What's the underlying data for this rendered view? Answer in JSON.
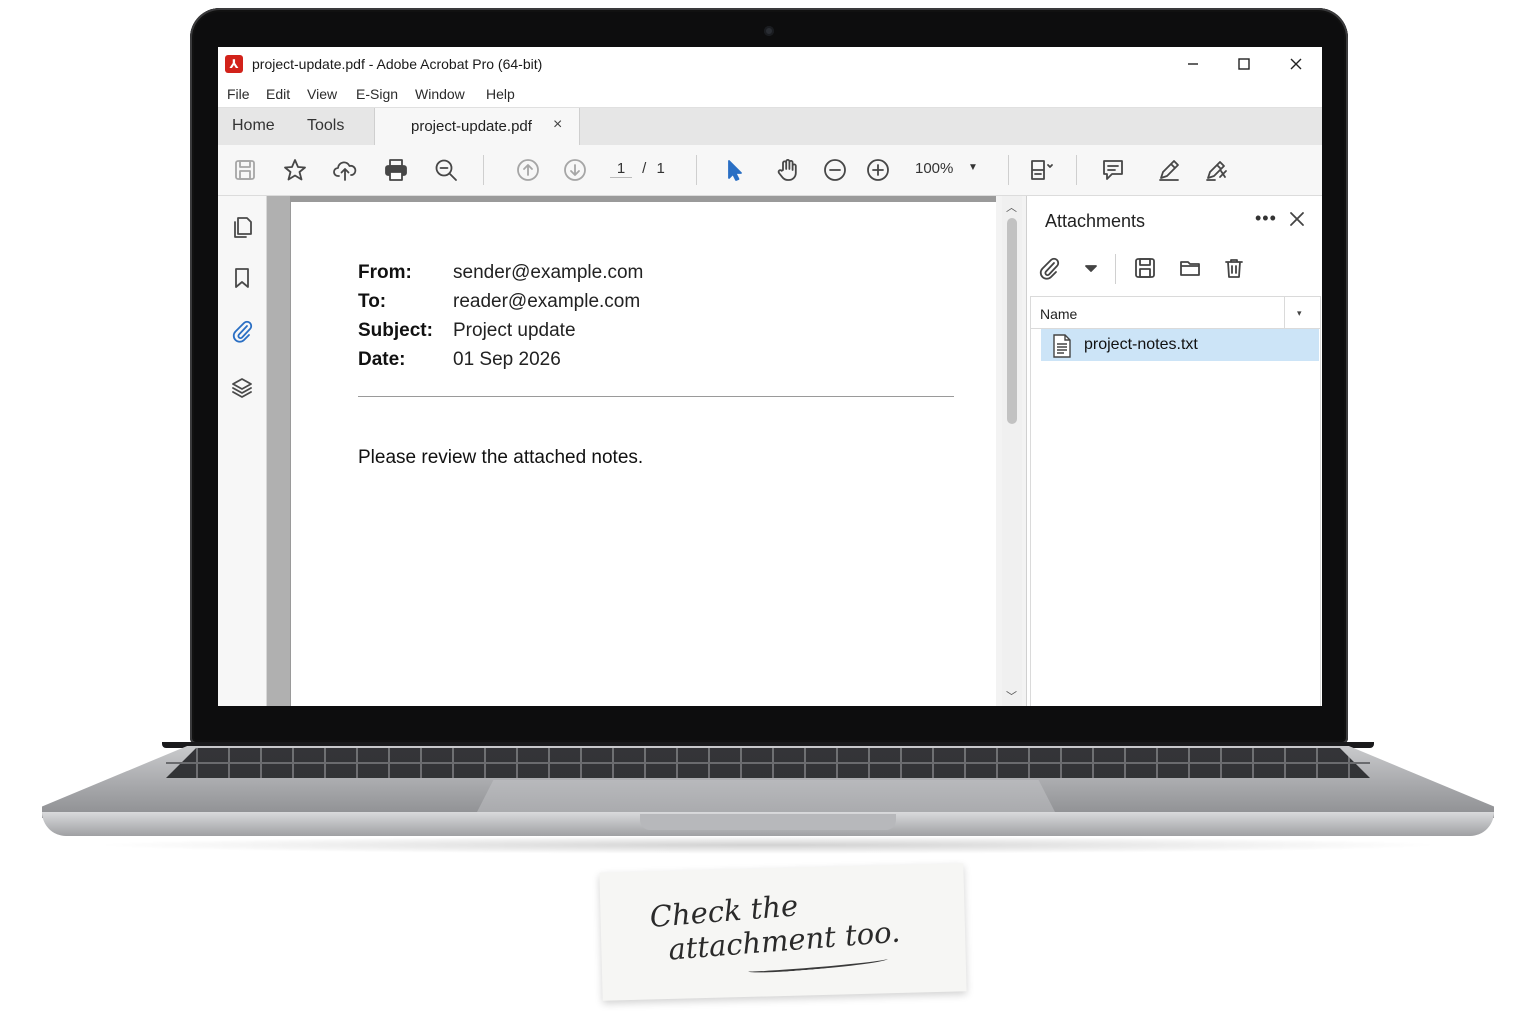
{
  "window": {
    "title": "project-update.pdf - Adobe Acrobat Pro (64-bit)",
    "app_icon": "acrobat-icon"
  },
  "menubar": {
    "items": [
      {
        "label": "File"
      },
      {
        "label": "Edit"
      },
      {
        "label": "View"
      },
      {
        "label": "E-Sign"
      },
      {
        "label": "Window"
      },
      {
        "label": "Help"
      }
    ]
  },
  "tabs": {
    "home": "Home",
    "tools": "Tools",
    "document": "project-update.pdf",
    "close_glyph": "×"
  },
  "toolbar": {
    "page_current": "1",
    "page_sep": "/",
    "page_total": "1",
    "zoom": "100%",
    "zoom_caret": "▼"
  },
  "document": {
    "fields": [
      {
        "label": "From:",
        "value": "sender@example.com"
      },
      {
        "label": "To:",
        "value": "reader@example.com"
      },
      {
        "label": "Subject:",
        "value": "Project update"
      },
      {
        "label": "Date:",
        "value": "01 Sep 2026"
      }
    ],
    "body": "Please review the attached notes."
  },
  "attachments_panel": {
    "title": "Attachments",
    "more": "•••",
    "column_name": "Name",
    "column_caret": "▾",
    "files": [
      {
        "name": "project-notes.txt",
        "selected": true
      }
    ]
  },
  "sticky_note": {
    "line1": "Check the",
    "line2": "attachment too."
  },
  "colors": {
    "accent": "#2a6fc4",
    "selection": "#cce4f7",
    "acrobat_red": "#d2221a"
  }
}
